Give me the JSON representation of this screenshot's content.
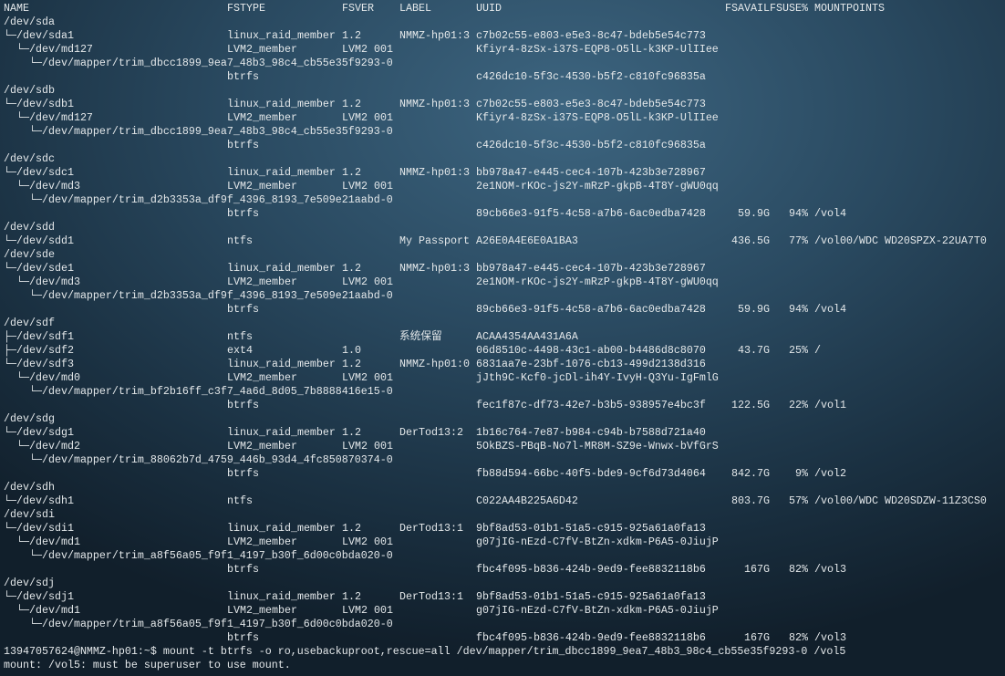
{
  "header": {
    "name": "NAME",
    "fstype": "FSTYPE",
    "fsver": "FSVER",
    "label": "LABEL",
    "uuid": "UUID",
    "fsavail": "FSAVAIL",
    "fsuse": "FSUSE%",
    "mount": "MOUNTPOINTS"
  },
  "rows": [
    {
      "name": "/dev/sda"
    },
    {
      "name": "└─/dev/sda1",
      "fstype": "linux_raid_member",
      "fsver": "1.2",
      "label": "NMMZ-hp01:3",
      "uuid": "c7b02c55-e803-e5e3-8c47-bdeb5e54c773"
    },
    {
      "name": "  └─/dev/md127",
      "fstype": "LVM2_member",
      "fsver": "LVM2 001",
      "uuid": "Kfiyr4-8zSx-i37S-EQP8-O5lL-k3KP-UlIIee"
    },
    {
      "name": "    └─/dev/mapper/trim_dbcc1899_9ea7_48b3_98c4_cb55e35f9293-0"
    },
    {
      "fstype": "btrfs",
      "uuid": "c426dc10-5f3c-4530-b5f2-c810fc96835a"
    },
    {
      "name": "/dev/sdb"
    },
    {
      "name": "└─/dev/sdb1",
      "fstype": "linux_raid_member",
      "fsver": "1.2",
      "label": "NMMZ-hp01:3",
      "uuid": "c7b02c55-e803-e5e3-8c47-bdeb5e54c773"
    },
    {
      "name": "  └─/dev/md127",
      "fstype": "LVM2_member",
      "fsver": "LVM2 001",
      "uuid": "Kfiyr4-8zSx-i37S-EQP8-O5lL-k3KP-UlIIee"
    },
    {
      "name": "    └─/dev/mapper/trim_dbcc1899_9ea7_48b3_98c4_cb55e35f9293-0"
    },
    {
      "fstype": "btrfs",
      "uuid": "c426dc10-5f3c-4530-b5f2-c810fc96835a"
    },
    {
      "name": "/dev/sdc"
    },
    {
      "name": "└─/dev/sdc1",
      "fstype": "linux_raid_member",
      "fsver": "1.2",
      "label": "NMMZ-hp01:3",
      "uuid": "bb978a47-e445-cec4-107b-423b3e728967"
    },
    {
      "name": "  └─/dev/md3",
      "fstype": "LVM2_member",
      "fsver": "LVM2 001",
      "uuid": "2e1NOM-rKOc-js2Y-mRzP-gkpB-4T8Y-gWU0qq"
    },
    {
      "name": "    └─/dev/mapper/trim_d2b3353a_df9f_4396_8193_7e509e21aabd-0"
    },
    {
      "fstype": "btrfs",
      "uuid": "89cb66e3-91f5-4c58-a7b6-6ac0edba7428",
      "fsavail": "59.9G",
      "fsuse": "94%",
      "mount": "/vol4"
    },
    {
      "name": "/dev/sdd"
    },
    {
      "name": "└─/dev/sdd1",
      "fstype": "ntfs",
      "label": "My Passport",
      "uuid": "A26E0A4E6E0A1BA3",
      "fsavail": "436.5G",
      "fsuse": "77%",
      "mount": "/vol00/WDC WD20SPZX-22UA7T0"
    },
    {
      "name": "/dev/sde"
    },
    {
      "name": "└─/dev/sde1",
      "fstype": "linux_raid_member",
      "fsver": "1.2",
      "label": "NMMZ-hp01:3",
      "uuid": "bb978a47-e445-cec4-107b-423b3e728967"
    },
    {
      "name": "  └─/dev/md3",
      "fstype": "LVM2_member",
      "fsver": "LVM2 001",
      "uuid": "2e1NOM-rKOc-js2Y-mRzP-gkpB-4T8Y-gWU0qq"
    },
    {
      "name": "    └─/dev/mapper/trim_d2b3353a_df9f_4396_8193_7e509e21aabd-0"
    },
    {
      "fstype": "btrfs",
      "uuid": "89cb66e3-91f5-4c58-a7b6-6ac0edba7428",
      "fsavail": "59.9G",
      "fsuse": "94%",
      "mount": "/vol4"
    },
    {
      "name": "/dev/sdf"
    },
    {
      "name": "├─/dev/sdf1",
      "fstype": "ntfs",
      "label": "系统保留",
      "uuid": "ACAA4354AA431A6A"
    },
    {
      "name": "├─/dev/sdf2",
      "fstype": "ext4",
      "fsver": "1.0",
      "uuid": "06d8510c-4498-43c1-ab00-b4486d8c8070",
      "fsavail": "43.7G",
      "fsuse": "25%",
      "mount": "/"
    },
    {
      "name": "└─/dev/sdf3",
      "fstype": "linux_raid_member",
      "fsver": "1.2",
      "label": "NMMZ-hp01:0",
      "uuid": "6831aa7e-23bf-1076-cb13-499d2138d316"
    },
    {
      "name": "  └─/dev/md0",
      "fstype": "LVM2_member",
      "fsver": "LVM2 001",
      "uuid": "jJth9C-Kcf0-jcDl-ih4Y-IvyH-Q3Yu-IgFmlG"
    },
    {
      "name": "    └─/dev/mapper/trim_bf2b16ff_c3f7_4a6d_8d05_7b8888416e15-0"
    },
    {
      "fstype": "btrfs",
      "uuid": "fec1f87c-df73-42e7-b3b5-938957e4bc3f",
      "fsavail": "122.5G",
      "fsuse": "22%",
      "mount": "/vol1"
    },
    {
      "name": "/dev/sdg"
    },
    {
      "name": "└─/dev/sdg1",
      "fstype": "linux_raid_member",
      "fsver": "1.2",
      "label": "DerTod13:2",
      "uuid": "1b16c764-7e87-b984-c94b-b7588d721a40"
    },
    {
      "name": "  └─/dev/md2",
      "fstype": "LVM2_member",
      "fsver": "LVM2 001",
      "uuid": "5OkBZS-PBqB-No7l-MR8M-SZ9e-Wnwx-bVfGrS"
    },
    {
      "name": "    └─/dev/mapper/trim_88062b7d_4759_446b_93d4_4fc850870374-0"
    },
    {
      "fstype": "btrfs",
      "uuid": "fb88d594-66bc-40f5-bde9-9cf6d73d4064",
      "fsavail": "842.7G",
      "fsuse": "9%",
      "mount": "/vol2"
    },
    {
      "name": "/dev/sdh"
    },
    {
      "name": "└─/dev/sdh1",
      "fstype": "ntfs",
      "uuid": "C022AA4B225A6D42",
      "fsavail": "803.7G",
      "fsuse": "57%",
      "mount": "/vol00/WDC WD20SDZW-11Z3CS0"
    },
    {
      "name": "/dev/sdi"
    },
    {
      "name": "└─/dev/sdi1",
      "fstype": "linux_raid_member",
      "fsver": "1.2",
      "label": "DerTod13:1",
      "uuid": "9bf8ad53-01b1-51a5-c915-925a61a0fa13"
    },
    {
      "name": "  └─/dev/md1",
      "fstype": "LVM2_member",
      "fsver": "LVM2 001",
      "uuid": "g07jIG-nEzd-C7fV-BtZn-xdkm-P6A5-0JiujP"
    },
    {
      "name": "    └─/dev/mapper/trim_a8f56a05_f9f1_4197_b30f_6d00c0bda020-0"
    },
    {
      "fstype": "btrfs",
      "uuid": "fbc4f095-b836-424b-9ed9-fee8832118b6",
      "fsavail": "167G",
      "fsuse": "82%",
      "mount": "/vol3"
    },
    {
      "name": "/dev/sdj"
    },
    {
      "name": "└─/dev/sdj1",
      "fstype": "linux_raid_member",
      "fsver": "1.2",
      "label": "DerTod13:1",
      "uuid": "9bf8ad53-01b1-51a5-c915-925a61a0fa13"
    },
    {
      "name": "  └─/dev/md1",
      "fstype": "LVM2_member",
      "fsver": "LVM2 001",
      "uuid": "g07jIG-nEzd-C7fV-BtZn-xdkm-P6A5-0JiujP"
    },
    {
      "name": "    └─/dev/mapper/trim_a8f56a05_f9f1_4197_b30f_6d00c0bda020-0"
    },
    {
      "fstype": "btrfs",
      "uuid": "fbc4f095-b836-424b-9ed9-fee8832118b6",
      "fsavail": "167G",
      "fsuse": "82%",
      "mount": "/vol3"
    }
  ],
  "command_line": "13947057624@NMMZ-hp01:~$ mount -t btrfs -o ro,usebackuproot,rescue=all /dev/mapper/trim_dbcc1899_9ea7_48b3_98c4_cb55e35f9293-0 /vol5",
  "error_line": "mount: /vol5: must be superuser to use mount."
}
